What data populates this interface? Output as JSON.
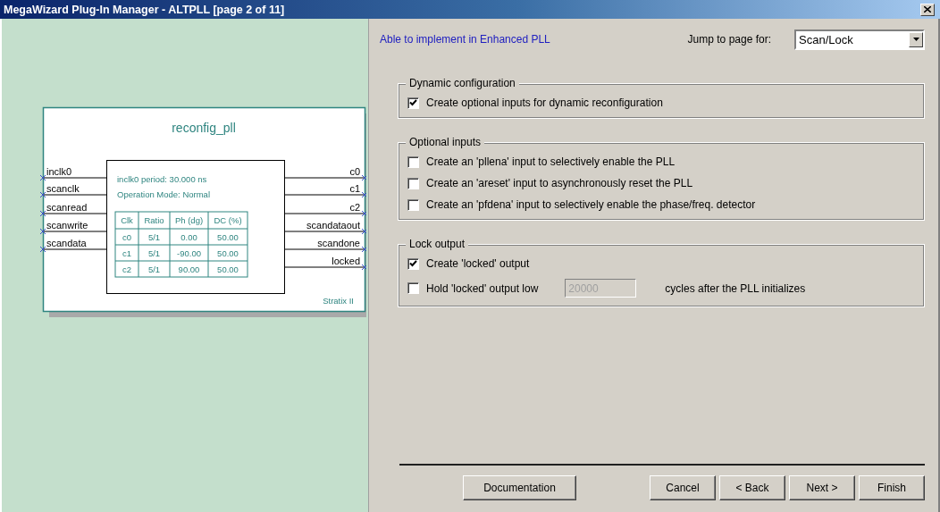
{
  "window": {
    "title": "MegaWizard Plug-In Manager - ALTPLL [page 2 of 11]"
  },
  "diagram": {
    "title": "reconfig_pll",
    "inputs": [
      "inclk0",
      "scanclk",
      "scanread",
      "scanwrite",
      "scandata"
    ],
    "outputs": [
      "c0",
      "c1",
      "c2",
      "scandataout",
      "scandone",
      "locked"
    ],
    "period": "inclk0 period: 30.000 ns",
    "mode": "Operation Mode: Normal",
    "table": {
      "columns": [
        "Clk",
        "Ratio",
        "Ph (dg)",
        "DC (%)"
      ],
      "rows": [
        [
          "c0",
          "5/1",
          "0.00",
          "50.00"
        ],
        [
          "c1",
          "5/1",
          "-90.00",
          "50.00"
        ],
        [
          "c2",
          "5/1",
          "90.00",
          "50.00"
        ]
      ]
    },
    "family": "Stratix II"
  },
  "status": "Able to implement in Enhanced PLL",
  "jump": {
    "label": "Jump to page for:",
    "value": "Scan/Lock"
  },
  "groups": [
    {
      "title": "Dynamic configuration",
      "options": [
        {
          "kind": "checkbox",
          "label": "Create optional inputs for dynamic reconfiguration",
          "checked": true
        }
      ]
    },
    {
      "title": "Optional inputs",
      "options": [
        {
          "kind": "checkbox",
          "label": "Create an 'pllena' input to selectively enable the PLL",
          "checked": false
        },
        {
          "kind": "checkbox",
          "label": "Create an 'areset' input to asynchronously reset the PLL",
          "checked": false
        },
        {
          "kind": "checkbox",
          "label": "Create an 'pfdena' input to selectively enable the phase/freq. detector",
          "checked": false
        }
      ]
    },
    {
      "title": "Lock output",
      "options": [
        {
          "kind": "checkbox",
          "label": "Create 'locked' output",
          "checked": true
        },
        {
          "kind": "checkbox-field",
          "label": "Hold 'locked' output low",
          "checked": false,
          "value": "20000",
          "disabled": true,
          "suffix": "cycles after the PLL initializes"
        }
      ]
    }
  ],
  "documentation_button": "Documentation",
  "nav_buttons": [
    "Cancel",
    "< Back",
    "Next >",
    "Finish"
  ]
}
